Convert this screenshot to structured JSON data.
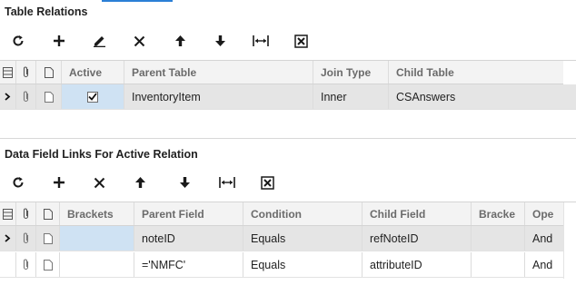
{
  "relations": {
    "title": "Table Relations",
    "headers": {
      "active": "Active",
      "parent_table": "Parent Table",
      "join_type": "Join Type",
      "child_table": "Child Table"
    },
    "rows": [
      {
        "active": true,
        "parent_table": "InventoryItem",
        "join_type": "Inner",
        "child_table": "CSAnswers"
      }
    ]
  },
  "links": {
    "title": "Data Field Links For Active Relation",
    "headers": {
      "brackets": "Brackets",
      "parent_field": "Parent Field",
      "condition": "Condition",
      "child_field": "Child Field",
      "brackets2": "Bracke",
      "operator": "Ope"
    },
    "rows": [
      {
        "brackets": "",
        "parent_field": "noteID",
        "condition": "Equals",
        "child_field": "refNoteID",
        "operator": "And"
      },
      {
        "brackets": "",
        "parent_field": "='NMFC'",
        "condition": "Equals",
        "child_field": "attributeID",
        "operator": "And"
      }
    ]
  },
  "icons": {
    "refresh": "refresh-icon",
    "add": "plus-icon",
    "edit": "pencil-icon",
    "delete": "x-icon",
    "up": "arrow-up-icon",
    "down": "arrow-down-icon",
    "fit": "fit-columns-icon",
    "export": "clear-x-box-icon",
    "row_selector": "row-selector-icon",
    "attachment": "paperclip-icon",
    "note": "note-icon"
  },
  "colors": {
    "accent": "#2b7fd6",
    "selected_cell": "#cfe2f3",
    "header_bg": "#f3f3f3",
    "selected_row": "#e5e5e5"
  }
}
